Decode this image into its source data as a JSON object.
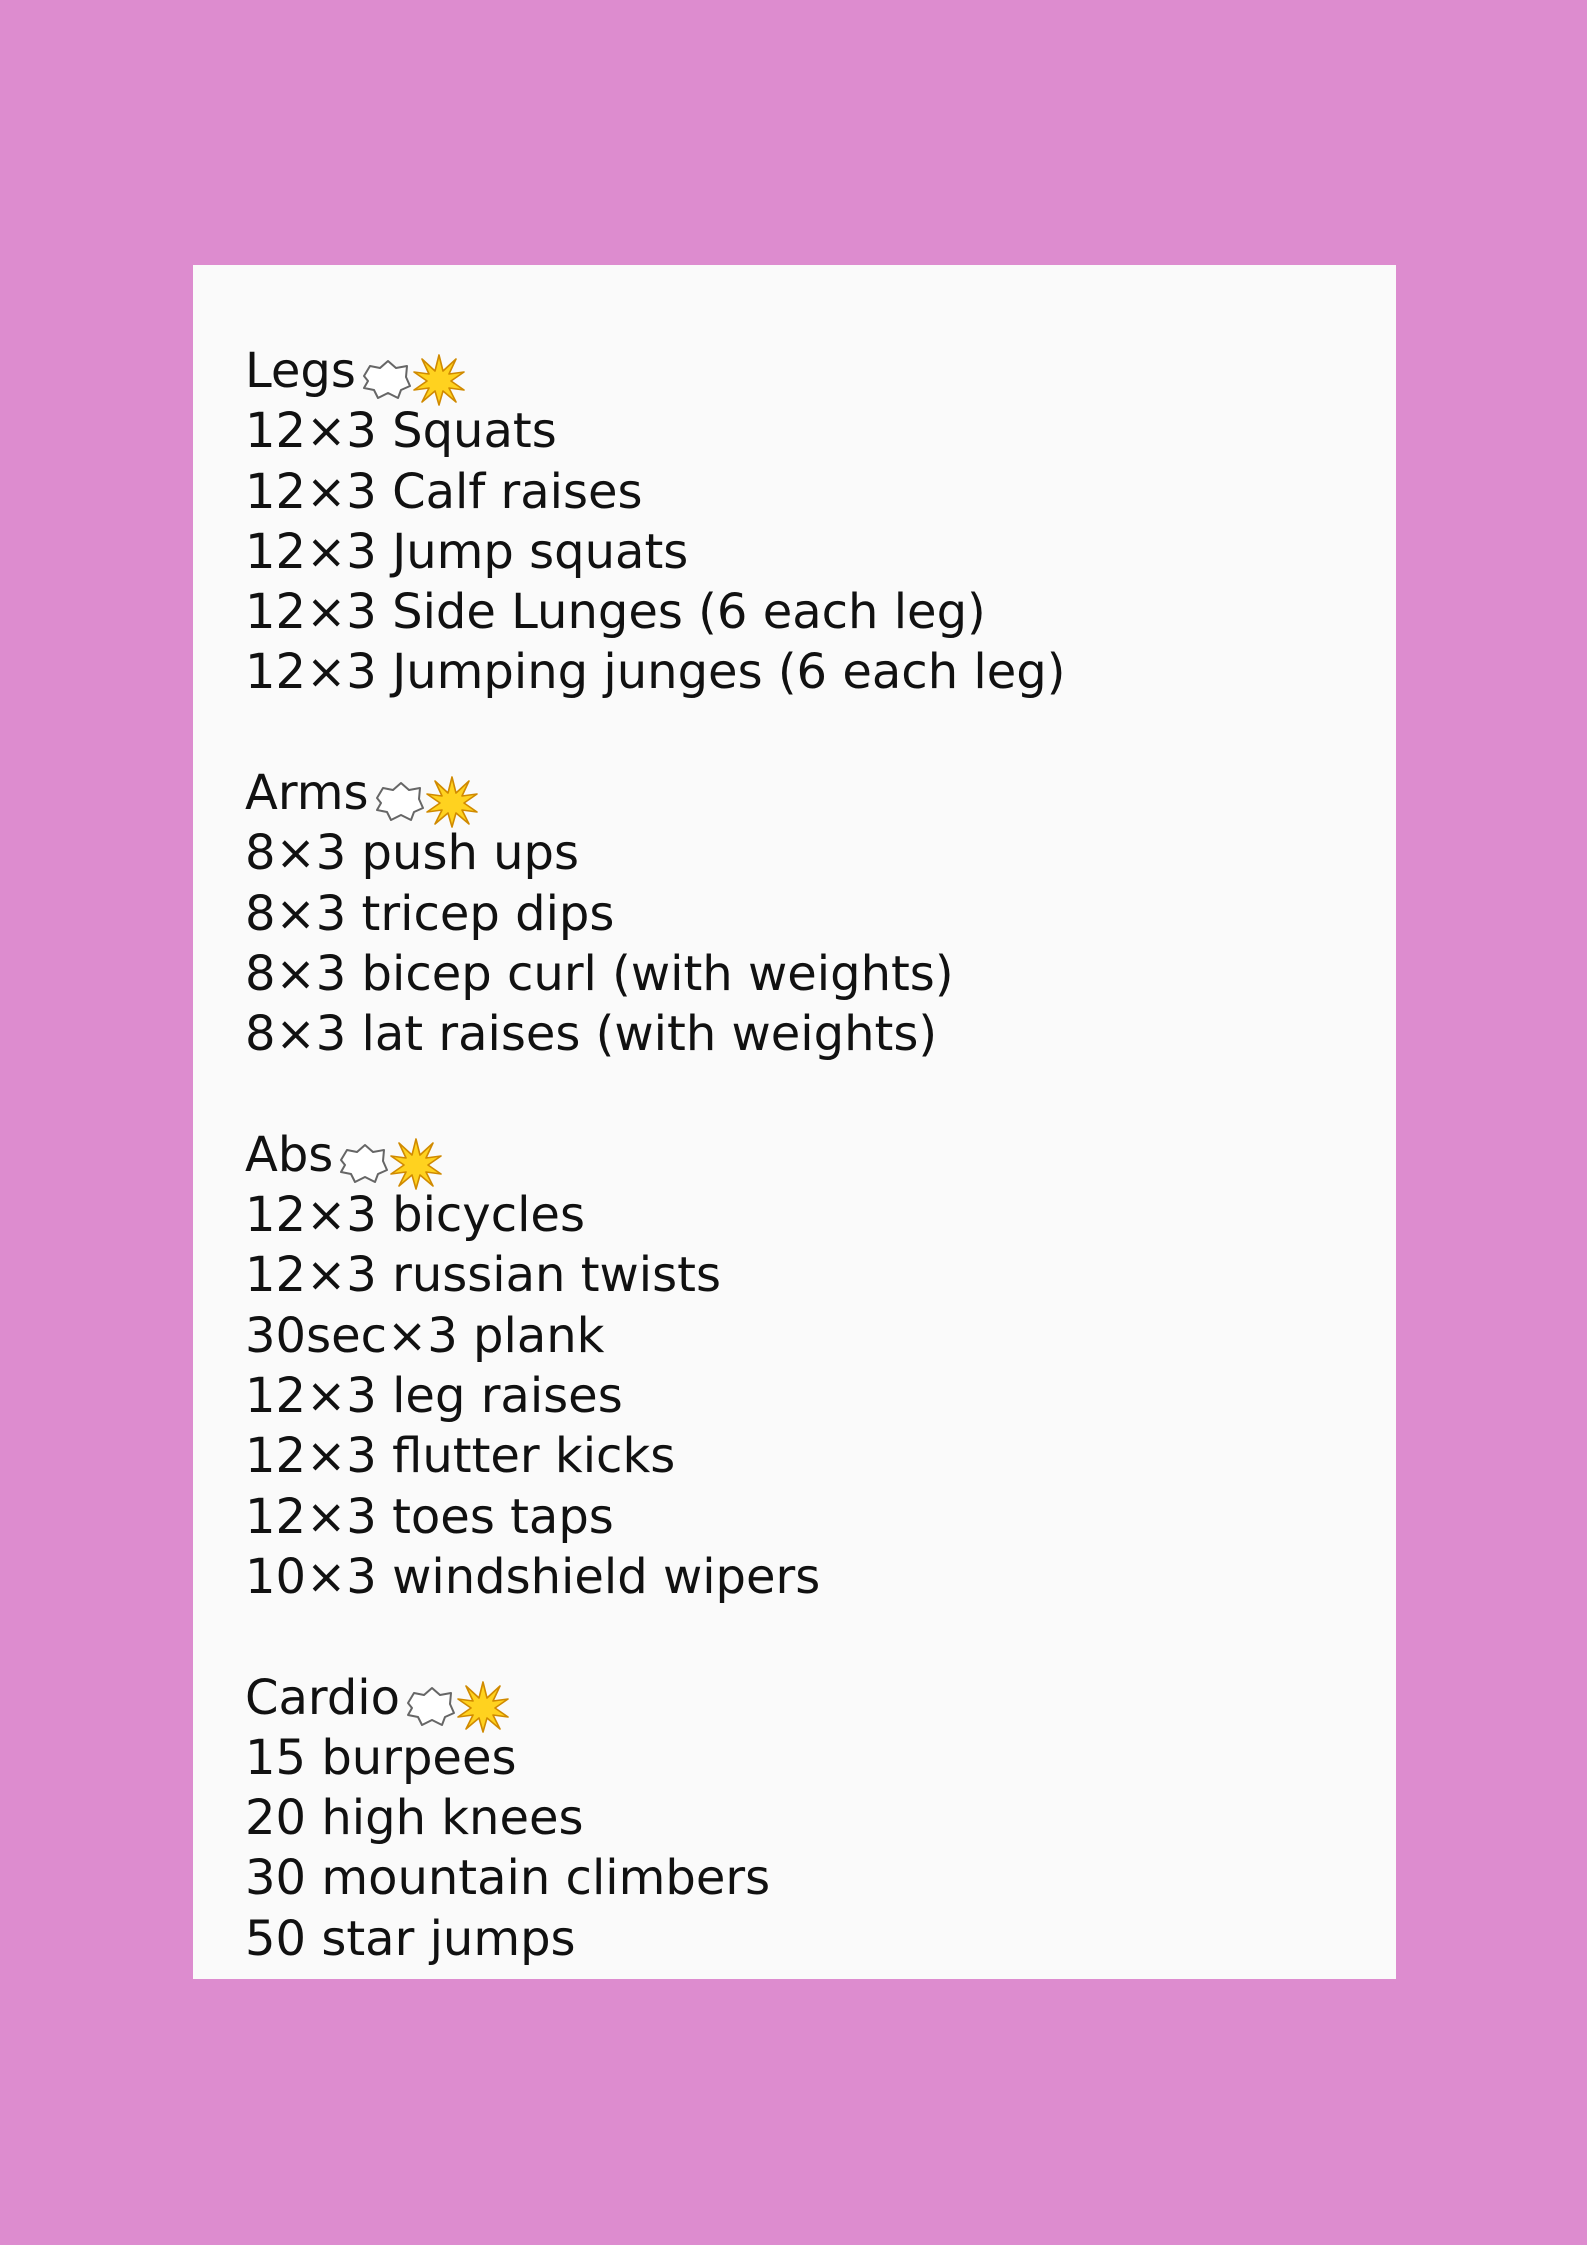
{
  "sections": [
    {
      "heading": "Legs",
      "icons": [
        "anger-bubble-icon",
        "explosion-star-icon"
      ],
      "items": [
        "12×3 Squats",
        "12×3 Calf raises",
        "12×3 Jump squats",
        "12×3 Side Lunges (6 each leg)",
        "12×3 Jumping junges (6 each leg)"
      ]
    },
    {
      "heading": "Arms",
      "icons": [
        "anger-bubble-icon",
        "explosion-star-icon"
      ],
      "items": [
        "8×3 push ups",
        "8×3 tricep dips",
        "8×3 bicep curl (with weights)",
        "8×3 lat raises (with weights)"
      ]
    },
    {
      "heading": "Abs",
      "icons": [
        "anger-bubble-icon",
        "explosion-star-icon"
      ],
      "items": [
        "12×3 bicycles",
        "12×3 russian twists",
        "30sec×3 plank",
        "12×3 leg raises",
        "12×3 flutter kicks",
        "12×3 toes taps",
        "10×3 windshield wipers"
      ]
    },
    {
      "heading": "Cardio",
      "icons": [
        "anger-bubble-icon",
        "explosion-star-icon"
      ],
      "items": [
        "15 burpees",
        "20 high knees",
        "30 mountain climbers",
        "50 star jumps"
      ]
    }
  ],
  "colors": {
    "background": "#dd8ccf",
    "card": "#fafafa",
    "text": "#111111",
    "star_fill": "#ffd21f",
    "star_outline": "#d08a00"
  }
}
